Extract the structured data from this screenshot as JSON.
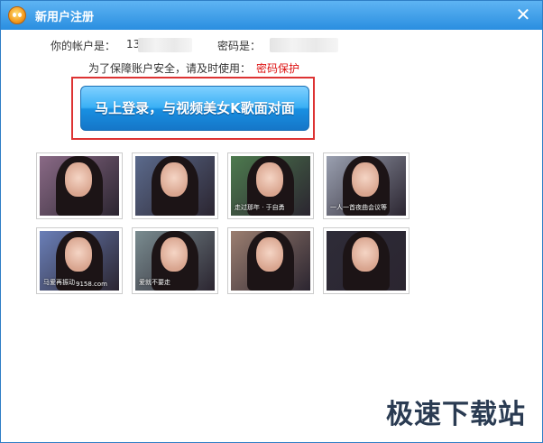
{
  "window": {
    "title": "新用户注册"
  },
  "account": {
    "account_label": "你的帐户是：",
    "account_value": "13",
    "password_label": "密码是：",
    "security_prompt": "为了保障账户安全，请及时使用：",
    "security_link": "密码保护"
  },
  "login_button": "马上登录，与视频美女K歌面对面",
  "thumbnails": [
    {
      "bg": "#8a6a86",
      "caption": ""
    },
    {
      "bg": "#5b6a8c",
      "caption": ""
    },
    {
      "bg": "#4d7a4e",
      "caption": "走过那年 · 于自勇"
    },
    {
      "bg": "#9aa0b0",
      "caption": "一人一首夜曲会议等"
    },
    {
      "bg": "#6a7fb8",
      "caption": "马爱再振动"
    },
    {
      "bg": "#7a8c90",
      "caption": "爱就不要走"
    },
    {
      "bg": "#9b7e70",
      "caption": ""
    },
    {
      "bg": "#2e2c38",
      "caption": ""
    }
  ],
  "thumbnail_watermark": "9158.com",
  "watermark": "极速下载站"
}
